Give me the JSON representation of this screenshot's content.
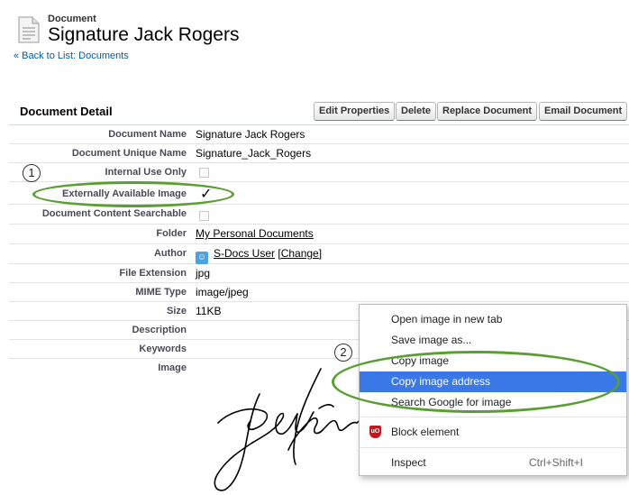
{
  "header": {
    "subtitle": "Document",
    "title": "Signature Jack Rogers",
    "back_link": "« Back to List: Documents"
  },
  "section": {
    "title": "Document Detail",
    "buttons": {
      "edit": "Edit Properties",
      "delete": "Delete",
      "replace": "Replace Document",
      "email": "Email Document"
    }
  },
  "fields": {
    "document_name": {
      "label": "Document Name",
      "value": "Signature Jack Rogers"
    },
    "unique_name": {
      "label": "Document Unique Name",
      "value": "Signature_Jack_Rogers"
    },
    "internal_use": {
      "label": "Internal Use Only",
      "checked": false
    },
    "externally_available": {
      "label": "Externally Available Image",
      "value": "✓",
      "checked": true
    },
    "content_searchable": {
      "label": "Document Content Searchable",
      "checked": false
    },
    "folder": {
      "label": "Folder",
      "value": "My Personal Documents"
    },
    "author": {
      "label": "Author",
      "value": "S-Docs User",
      "change_link": "[Change]"
    },
    "file_extension": {
      "label": "File Extension",
      "value": "jpg"
    },
    "mime_type": {
      "label": "MIME Type",
      "value": "image/jpeg"
    },
    "size": {
      "label": "Size",
      "value": "11KB"
    },
    "description": {
      "label": "Description",
      "value": ""
    },
    "keywords": {
      "label": "Keywords",
      "value": ""
    },
    "image": {
      "label": "Image"
    }
  },
  "annotations": {
    "step1": "1",
    "step2": "2"
  },
  "context_menu": {
    "items": [
      {
        "label": "Open image in new tab"
      },
      {
        "label": "Save image as..."
      },
      {
        "label": "Copy image"
      },
      {
        "label": "Copy image address",
        "selected": true
      },
      {
        "label": "Search Google for image"
      },
      {
        "label": "Block element"
      },
      {
        "label": "Inspect",
        "shortcut": "Ctrl+Shift+I"
      }
    ]
  },
  "colors": {
    "link": "#015ba7",
    "highlight_ring": "#5a9e34",
    "menu_selection": "#3b78e7",
    "ublock_red": "#c4161c"
  }
}
